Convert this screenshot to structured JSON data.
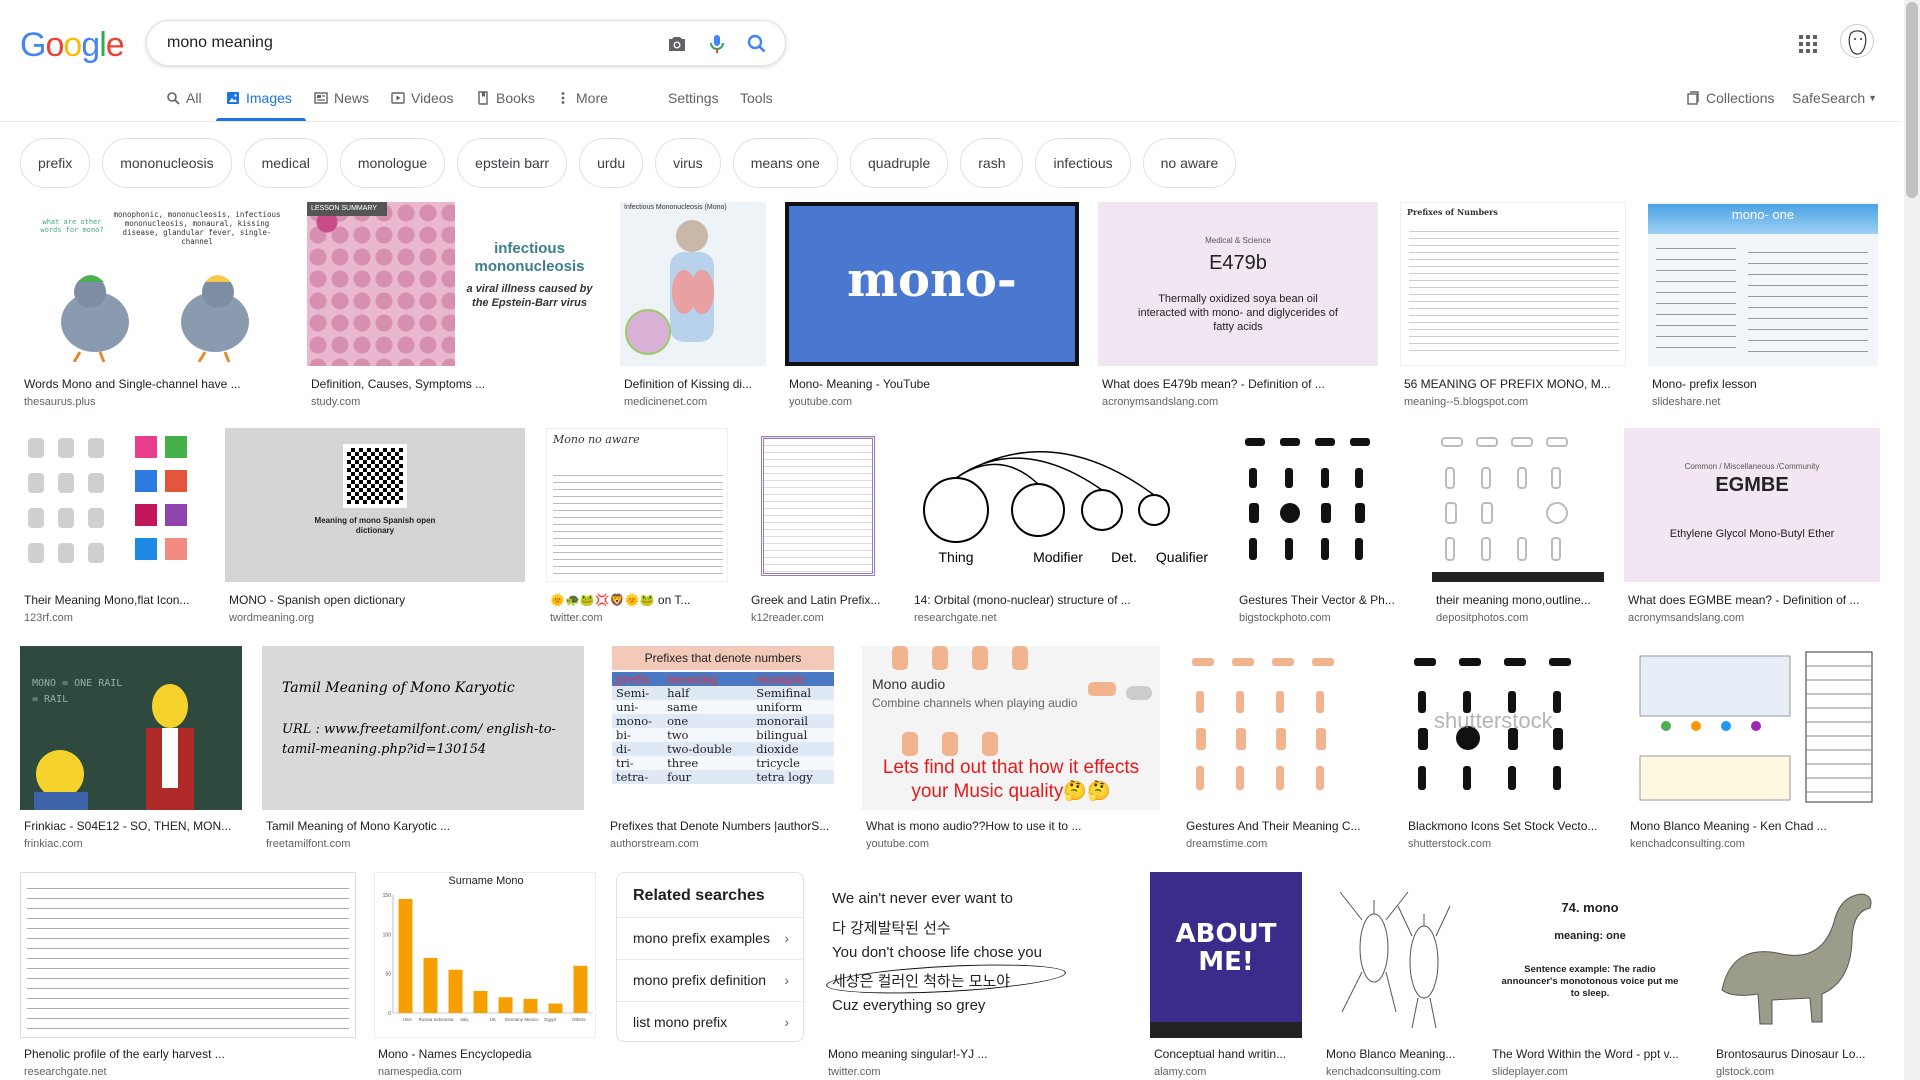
{
  "logo": {
    "text": "Google"
  },
  "search": {
    "query": "mono meaning"
  },
  "tabs": {
    "all": "All",
    "images": "Images",
    "news": "News",
    "videos": "Videos",
    "books": "Books",
    "more": "More",
    "settings": "Settings",
    "tools": "Tools",
    "collections": "Collections",
    "safesearch": "SafeSearch"
  },
  "chips": [
    "prefix",
    "mononucleosis",
    "medical",
    "monologue",
    "epstein barr",
    "urdu",
    "virus",
    "means one",
    "quadruple",
    "rash",
    "infectious",
    "no aware"
  ],
  "results": [
    {
      "caption": "Words Mono and Single-channel have ...",
      "source": "thesaurus.plus",
      "thumb_text": "monophonic, mononucleosis, infectious mononucleosis, monaural, kissing disease, glandular fever, single-channel",
      "thumb_text2": "what are other words for mono?"
    },
    {
      "caption": "Definition, Causes, Symptoms ...",
      "source": "study.com",
      "thumb_text": "infectious mononucleosis",
      "thumb_text2": "a viral illness caused by the Epstein-Barr virus",
      "thumb_text3": "LESSON SUMMARY"
    },
    {
      "caption": "Definition of Kissing di...",
      "source": "medicinenet.com",
      "thumb_text": "Infectious Mononucleosis (Mono)"
    },
    {
      "caption": "Mono- Meaning - YouTube",
      "source": "youtube.com",
      "thumb_text": "mono-"
    },
    {
      "caption": "What does E479b mean? - Definition of ...",
      "source": "acronymsandslang.com",
      "thumb_text": "E479b",
      "thumb_text2": "Thermally oxidized soya bean oil interacted with mono- and diglycerides of fatty acids",
      "thumb_text3": "Medical & Science"
    },
    {
      "caption": "56 MEANING OF PREFIX MONO, M...",
      "source": "meaning--5.blogspot.com",
      "thumb_text": "Prefixes of Numbers"
    },
    {
      "caption": "Mono- prefix lesson",
      "source": "slideshare.net",
      "thumb_text": "mono- one"
    },
    {
      "caption": "Their Meaning Mono,flat Icon...",
      "source": "123rf.com"
    },
    {
      "caption": "MONO - Spanish open dictionary",
      "source": "wordmeaning.org",
      "thumb_text": "Meaning of mono Spanish open dictionary"
    },
    {
      "caption": "🌞🐢🐸💢🦁🌞🐸 on T...",
      "source": "twitter.com",
      "thumb_text": "Mono no aware"
    },
    {
      "caption": "Greek and Latin Prefix...",
      "source": "k12reader.com"
    },
    {
      "caption": "14: Orbital (mono-nuclear) structure of ...",
      "source": "researchgate.net",
      "labels": [
        "Thing",
        "Modifier",
        "Det.",
        "Qualifier"
      ]
    },
    {
      "caption": "Gestures Their Vector & Ph...",
      "source": "bigstockphoto.com"
    },
    {
      "caption": "their meaning mono,outline...",
      "source": "depositphotos.com"
    },
    {
      "caption": "What does EGMBE mean? - Definition of ...",
      "source": "acronymsandslang.com",
      "thumb_text": "EGMBE",
      "thumb_text2": "Ethylene Glycol Mono-Butyl Ether",
      "thumb_text3": "Common / Miscellaneous /Community"
    },
    {
      "caption": "Frinkiac - S04E12 - SO, THEN, MON...",
      "source": "frinkiac.com",
      "thumb_text": "MONO = ONE RAIL = RAIL"
    },
    {
      "caption": "Tamil Meaning of Mono Karyotic ...",
      "source": "freetamilfont.com",
      "thumb_text": "Tamil Meaning of Mono Karyotic",
      "thumb_text2": "URL : www.freetamilfont.com/ english-to-tamil-meaning.php?id=130154"
    },
    {
      "caption": "Prefixes that Denote Numbers |authorS...",
      "source": "authorstream.com",
      "thumb_text": "Prefixes that denote numbers",
      "table": {
        "head": [
          "prefix",
          "meaning",
          "example"
        ],
        "rows": [
          [
            "Semi-",
            "half",
            "Semifinal"
          ],
          [
            "uni-",
            "same",
            "uniform"
          ],
          [
            "mono-",
            "one",
            "monorail"
          ],
          [
            "bi-",
            "two",
            "bilingual"
          ],
          [
            "di-",
            "two-double",
            "dioxide"
          ],
          [
            "tri-",
            "three",
            "tricycle"
          ],
          [
            "tetra-",
            "four",
            "tetra logy"
          ]
        ]
      }
    },
    {
      "caption": "What is mono audio??How to use it to ...",
      "source": "youtube.com",
      "thumb_text": "Mono audio",
      "thumb_text2": "Combine channels when playing audio",
      "thumb_text3": "Lets find out that how it effects your Music quality🤔🤔"
    },
    {
      "caption": "Gestures And Their Meaning C...",
      "source": "dreamstime.com"
    },
    {
      "caption": "Blackmono Icons Set Stock Vecto...",
      "source": "shutterstock.com",
      "thumb_text": "shutterstock"
    },
    {
      "caption": "Mono Blanco Meaning - Ken Chad ...",
      "source": "kenchadconsulting.com"
    },
    {
      "caption": "Phenolic profile of the early harvest ...",
      "source": "researchgate.net"
    },
    {
      "caption": "Mono - Names Encyclopedia",
      "source": "namespedia.com",
      "thumb_text": "Surname Mono"
    },
    {
      "caption": "Mono meaning singular!-YJ ...",
      "source": "twitter.com",
      "lines": [
        "We ain't never ever want to",
        "다 강제발탁된 선수",
        "You don't choose life chose you",
        "세상은 컬러인 척하는 모노야",
        "Cuz everything so grey"
      ]
    },
    {
      "caption": "Conceptual hand writin...",
      "source": "alamy.com",
      "thumb_text": "ABOUT ME!"
    },
    {
      "caption": "Mono Blanco Meaning...",
      "source": "kenchadconsulting.com"
    },
    {
      "caption": "The Word Within the Word - ppt v...",
      "source": "slideplayer.com",
      "thumb_text": "74. mono",
      "thumb_text2": "meaning: one",
      "thumb_text3": "Sentence example: The radio announcer's monotonous voice put me to sleep."
    },
    {
      "caption": "Brontosaurus Dinosaur Lo...",
      "source": "glstock.com"
    }
  ],
  "related": {
    "title": "Related searches",
    "items": [
      "mono prefix examples",
      "mono prefix definition",
      "list mono prefix"
    ]
  },
  "chart_data": {
    "type": "bar",
    "title": "Surname Mono",
    "categories": [
      "USA",
      "Russia Indonesia",
      "Italy",
      "UK",
      "Germany Mexico",
      "Egypt",
      "Others"
    ],
    "values": [
      145,
      70,
      55,
      28,
      20,
      18,
      12,
      60
    ],
    "ylim": [
      0,
      150
    ],
    "color": "#f5a000"
  },
  "colors": {
    "blue": "#1a73e8",
    "grey": "#5f6368"
  }
}
